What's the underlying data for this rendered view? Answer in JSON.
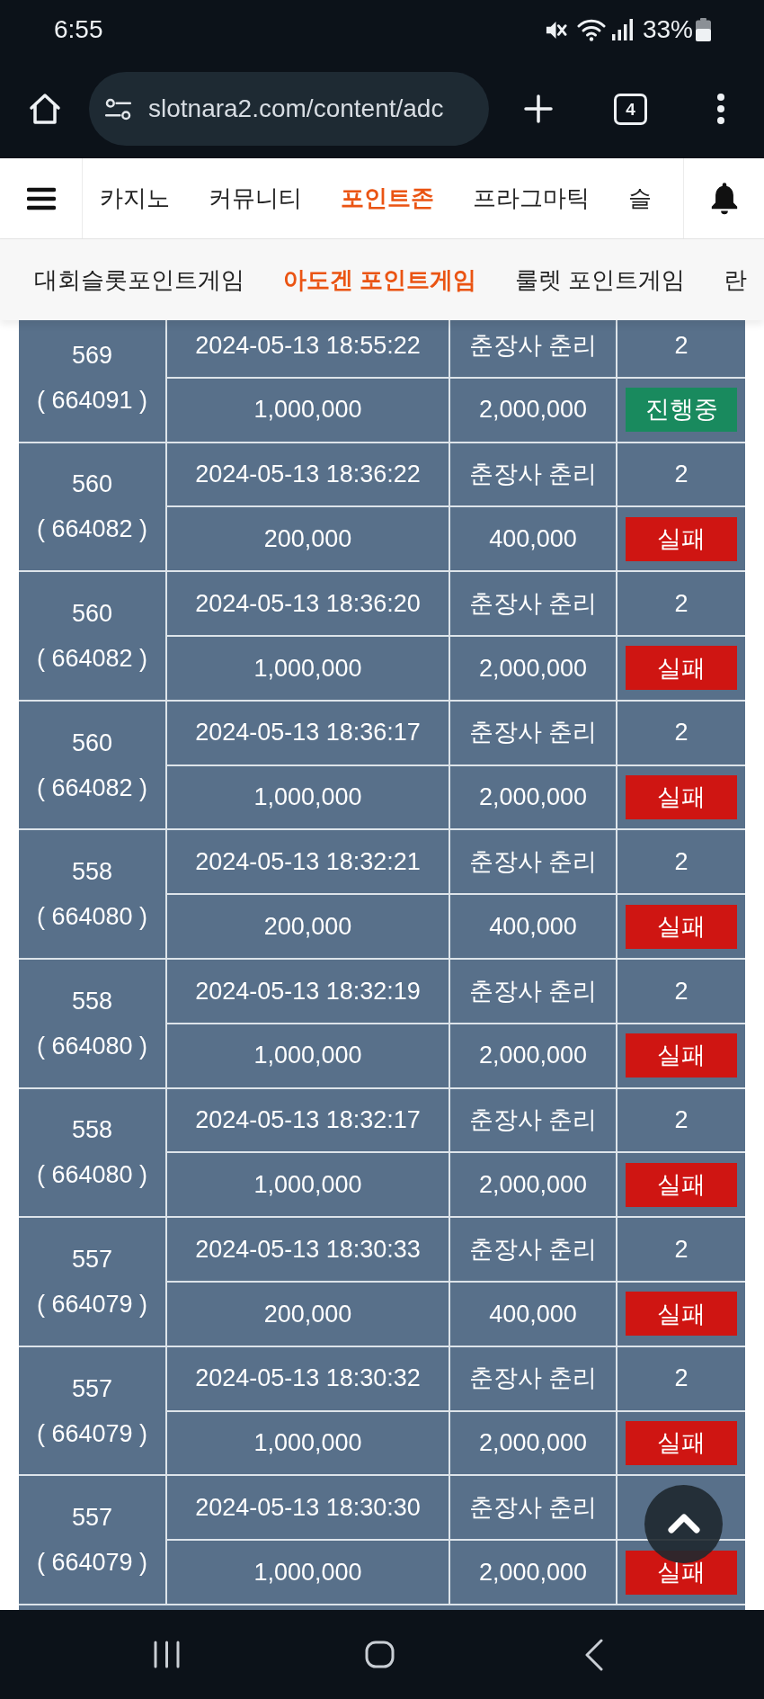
{
  "status_bar": {
    "time": "6:55",
    "battery": "33%"
  },
  "browser_toolbar": {
    "url": "slotnara2.com/content/adc",
    "tab_count": "4"
  },
  "nav": {
    "items": [
      {
        "label": "카지노",
        "selected": false
      },
      {
        "label": "커뮤니티",
        "selected": false
      },
      {
        "label": "포인트존",
        "selected": true
      },
      {
        "label": "프라그마틱",
        "selected": false
      },
      {
        "label": "슬",
        "selected": false
      }
    ]
  },
  "sub_nav": {
    "items": [
      {
        "label": "대회슬롯포인트게임",
        "selected": false
      },
      {
        "label": "아도겐 포인트게임",
        "selected": true
      },
      {
        "label": "룰렛 포인트게임",
        "selected": false
      },
      {
        "label": "란",
        "selected": false
      }
    ]
  },
  "table": {
    "rows": [
      {
        "column_1": [
          "569",
          "( 664091 )"
        ],
        "column_2": [
          "2024-05-13 18:55:22",
          "1,000,000"
        ],
        "column_3": [
          "춘장사 춘리",
          "2,000,000"
        ],
        "column_4": "2",
        "status": {
          "label": "진행중",
          "color": "#198a5e"
        }
      },
      {
        "column_1": [
          "560",
          "( 664082 )"
        ],
        "column_2": [
          "2024-05-13 18:36:22",
          "200,000"
        ],
        "column_3": [
          "춘장사 춘리",
          "400,000"
        ],
        "column_4": "2",
        "status": {
          "label": "실패",
          "color": "#cf1512"
        }
      },
      {
        "column_1": [
          "560",
          "( 664082 )"
        ],
        "column_2": [
          "2024-05-13 18:36:20",
          "1,000,000"
        ],
        "column_3": [
          "춘장사 춘리",
          "2,000,000"
        ],
        "column_4": "2",
        "status": {
          "label": "실패",
          "color": "#cf1512"
        }
      },
      {
        "column_1": [
          "560",
          "( 664082 )"
        ],
        "column_2": [
          "2024-05-13 18:36:17",
          "1,000,000"
        ],
        "column_3": [
          "춘장사 춘리",
          "2,000,000"
        ],
        "column_4": "2",
        "status": {
          "label": "실패",
          "color": "#cf1512"
        }
      },
      {
        "column_1": [
          "558",
          "( 664080 )"
        ],
        "column_2": [
          "2024-05-13 18:32:21",
          "200,000"
        ],
        "column_3": [
          "춘장사 춘리",
          "400,000"
        ],
        "column_4": "2",
        "status": {
          "label": "실패",
          "color": "#cf1512"
        }
      },
      {
        "column_1": [
          "558",
          "( 664080 )"
        ],
        "column_2": [
          "2024-05-13 18:32:19",
          "1,000,000"
        ],
        "column_3": [
          "춘장사 춘리",
          "2,000,000"
        ],
        "column_4": "2",
        "status": {
          "label": "실패",
          "color": "#cf1512"
        }
      },
      {
        "column_1": [
          "558",
          "( 664080 )"
        ],
        "column_2": [
          "2024-05-13 18:32:17",
          "1,000,000"
        ],
        "column_3": [
          "춘장사 춘리",
          "2,000,000"
        ],
        "column_4": "2",
        "status": {
          "label": "실패",
          "color": "#cf1512"
        }
      },
      {
        "column_1": [
          "557",
          "( 664079 )"
        ],
        "column_2": [
          "2024-05-13 18:30:33",
          "200,000"
        ],
        "column_3": [
          "춘장사 춘리",
          "400,000"
        ],
        "column_4": "2",
        "status": {
          "label": "실패",
          "color": "#cf1512"
        }
      },
      {
        "column_1": [
          "557",
          "( 664079 )"
        ],
        "column_2": [
          "2024-05-13 18:30:32",
          "1,000,000"
        ],
        "column_3": [
          "춘장사 춘리",
          "2,000,000"
        ],
        "column_4": "2",
        "status": {
          "label": "실패",
          "color": "#cf1512"
        }
      },
      {
        "column_1": [
          "557",
          "( 664079 )"
        ],
        "column_2": [
          "2024-05-13 18:30:30",
          "1,000,000"
        ],
        "column_3": [
          "춘장사 춘리",
          "2,000,000"
        ],
        "status": {
          "label": "실패",
          "color": "#cf1512"
        }
      }
    ]
  }
}
